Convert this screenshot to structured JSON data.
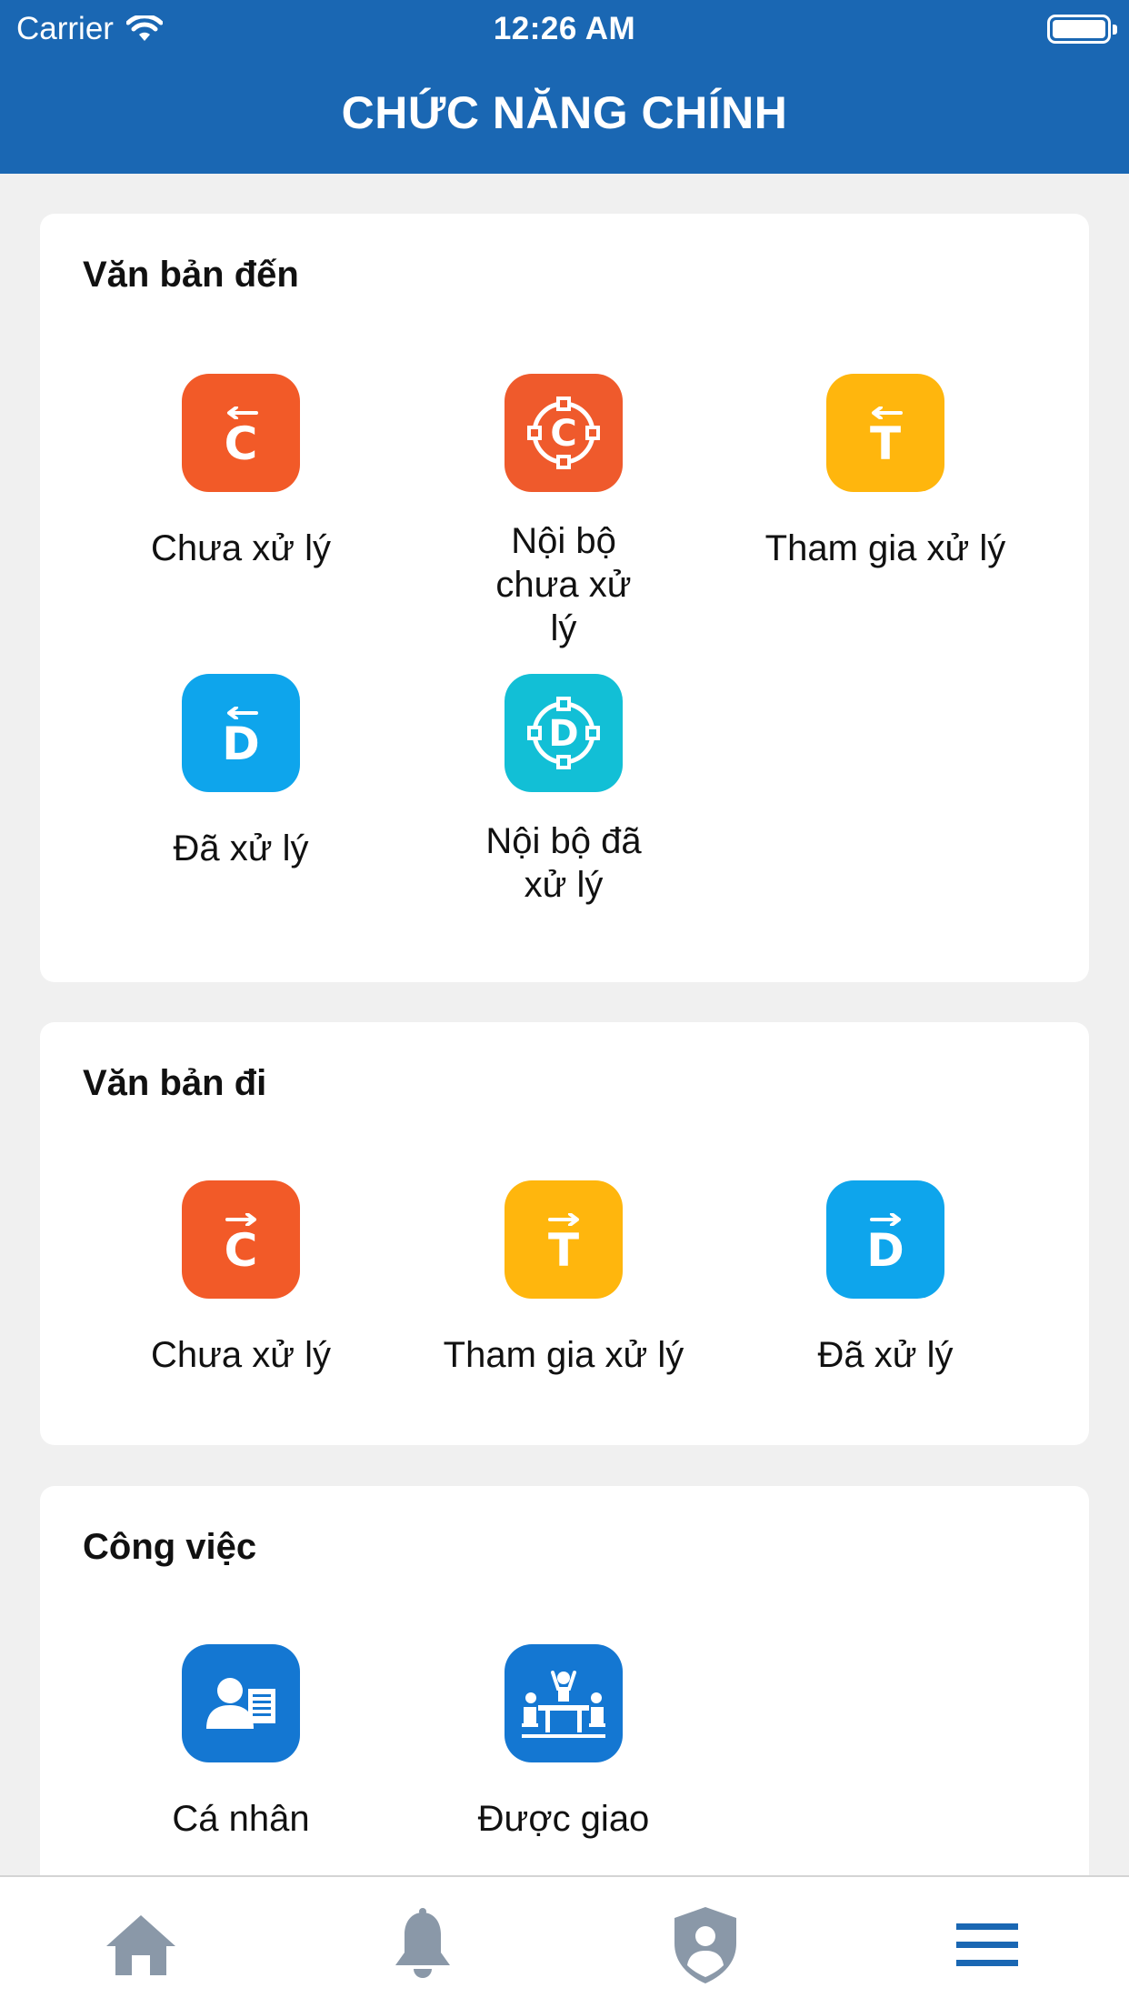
{
  "status_bar": {
    "carrier": "Carrier",
    "time": "12:26 AM"
  },
  "header": {
    "title": "CHỨC NĂNG CHÍNH"
  },
  "sections": {
    "incoming": {
      "title": "Văn bản đến",
      "items": [
        {
          "label": "Chưa xử lý",
          "icon": "incoming-c-icon",
          "letter": "C",
          "color": "#f25a28"
        },
        {
          "label": "Nội bộ chưa xử lý",
          "icon": "internal-c-icon",
          "letter": "C",
          "color": "#ef5a2c"
        },
        {
          "label": "Tham gia xử lý",
          "icon": "incoming-t-icon",
          "letter": "T",
          "color": "#ffb60d"
        },
        {
          "label": "Đã xử lý",
          "icon": "incoming-d-icon",
          "letter": "D",
          "color": "#0ea5ec"
        },
        {
          "label": "Nội bộ đã xử lý",
          "icon": "internal-d-icon",
          "letter": "D",
          "color": "#12bfd6"
        }
      ]
    },
    "outgoing": {
      "title": "Văn bản đi",
      "items": [
        {
          "label": "Chưa xử lý",
          "icon": "outgoing-c-icon",
          "letter": "C",
          "color": "#f25a28"
        },
        {
          "label": "Tham gia xử lý",
          "icon": "outgoing-t-icon",
          "letter": "T",
          "color": "#ffb60d"
        },
        {
          "label": "Đã xử lý",
          "icon": "outgoing-d-icon",
          "letter": "D",
          "color": "#0ea5ec"
        }
      ]
    },
    "tasks": {
      "title": "Công việc",
      "items": [
        {
          "label": "Cá nhân",
          "icon": "person-document-icon",
          "color": "#1477d2"
        },
        {
          "label": "Được giao",
          "icon": "meeting-icon",
          "color": "#1477d2"
        }
      ]
    }
  },
  "tabbar": {
    "tabs": [
      {
        "icon": "home-icon",
        "color": "#8a98a8"
      },
      {
        "icon": "bell-icon",
        "color": "#8a98a8"
      },
      {
        "icon": "shield-user-icon",
        "color": "#8a98a8"
      },
      {
        "icon": "menu-icon",
        "color": "#1a67b3"
      }
    ]
  }
}
